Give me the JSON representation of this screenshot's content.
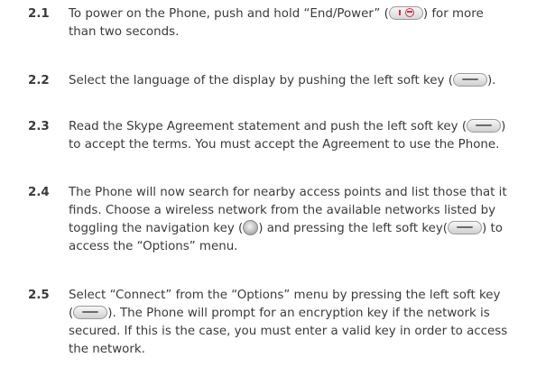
{
  "steps": [
    {
      "number": "2.1",
      "lines": [
        [
          "To power on the Phone, push and hold “End/Power” (",
          ") for more"
        ],
        [
          "than two seconds."
        ]
      ]
    },
    {
      "number": "2.2",
      "lines": [
        [
          "Select the language of the display by pushing the left soft key (",
          ")."
        ]
      ]
    },
    {
      "number": "2.3",
      "lines": [
        [
          "Read the Skype Agreement statement and push the left soft key (",
          ")"
        ],
        [
          "to accept the terms. You must accept the Agreement to use the Phone."
        ]
      ]
    },
    {
      "number": "2.4",
      "lines": [
        [
          "The Phone will now search for nearby access points and list those that it"
        ],
        [
          "finds. Choose a wireless network from the available networks listed by"
        ],
        [
          "toggling the navigation key (",
          ") and pressing the left soft key(",
          ") to"
        ],
        [
          "access the “Options” menu."
        ]
      ]
    },
    {
      "number": "2.5",
      "lines": [
        [
          "Select “Connect” from the “Options” menu by pressing the left soft key"
        ],
        [
          "(",
          "). The Phone will prompt for an encryption key if the network is"
        ],
        [
          "secured. If this is the case, you must enter a valid key in order to access"
        ],
        [
          "the network."
        ]
      ]
    }
  ],
  "icons": {
    "power_key": "end-power-key-icon",
    "soft_key": "left-soft-key-icon",
    "nav_key": "navigation-key-icon"
  }
}
